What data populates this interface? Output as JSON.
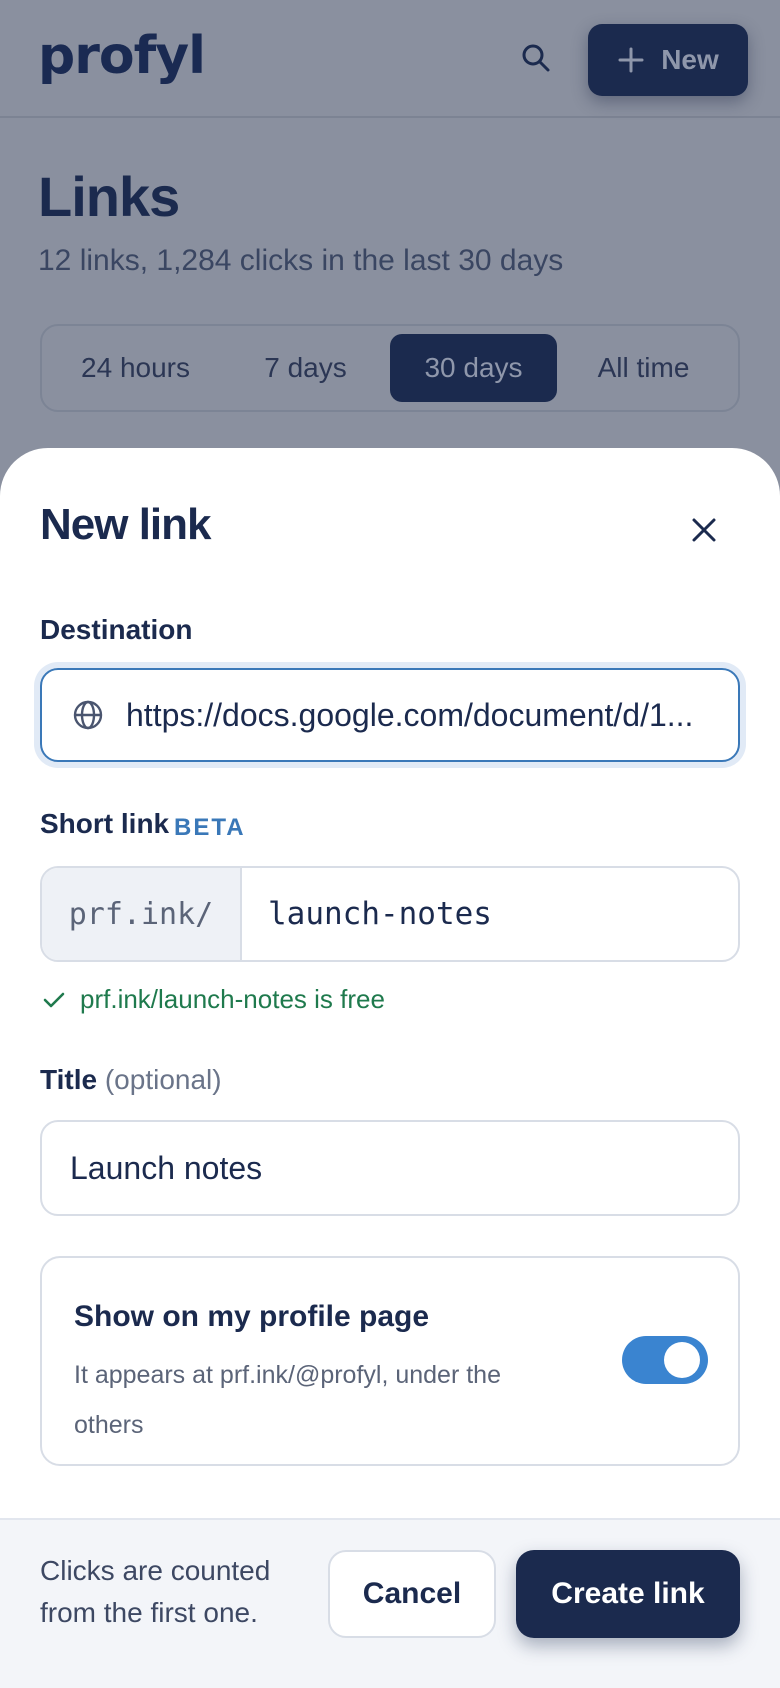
{
  "header": {
    "logo": "profyl",
    "new_button_label": "New"
  },
  "page": {
    "title": "Links",
    "subtitle": "12 links, 1,284 clicks in the last 30 days",
    "ranges": [
      "24 hours",
      "7 days",
      "30 days",
      "All time"
    ],
    "selected_range": "30 days"
  },
  "sheet": {
    "title": "New link",
    "destination": {
      "label": "Destination",
      "value": "https://docs.google.com/document/d/1..."
    },
    "short_link": {
      "label": "Short link",
      "badge": "BETA",
      "prefix": "prf.ink/",
      "value": "launch-notes",
      "availability": "prf.ink/launch-notes is free"
    },
    "title_field": {
      "label": "Title",
      "optional_hint": "(optional)",
      "value": "Launch notes"
    },
    "profile_toggle": {
      "title": "Show on my profile page",
      "description": "It appears at prf.ink/@profyl, under the others",
      "enabled": true
    }
  },
  "footer": {
    "note": "Clicks are counted from the first one.",
    "cancel_label": "Cancel",
    "create_label": "Create link"
  },
  "colors": {
    "primary": "#1b2a4e",
    "accent": "#3a78b8",
    "success": "#1f7a4d",
    "toggle_on": "#3a84d0"
  }
}
